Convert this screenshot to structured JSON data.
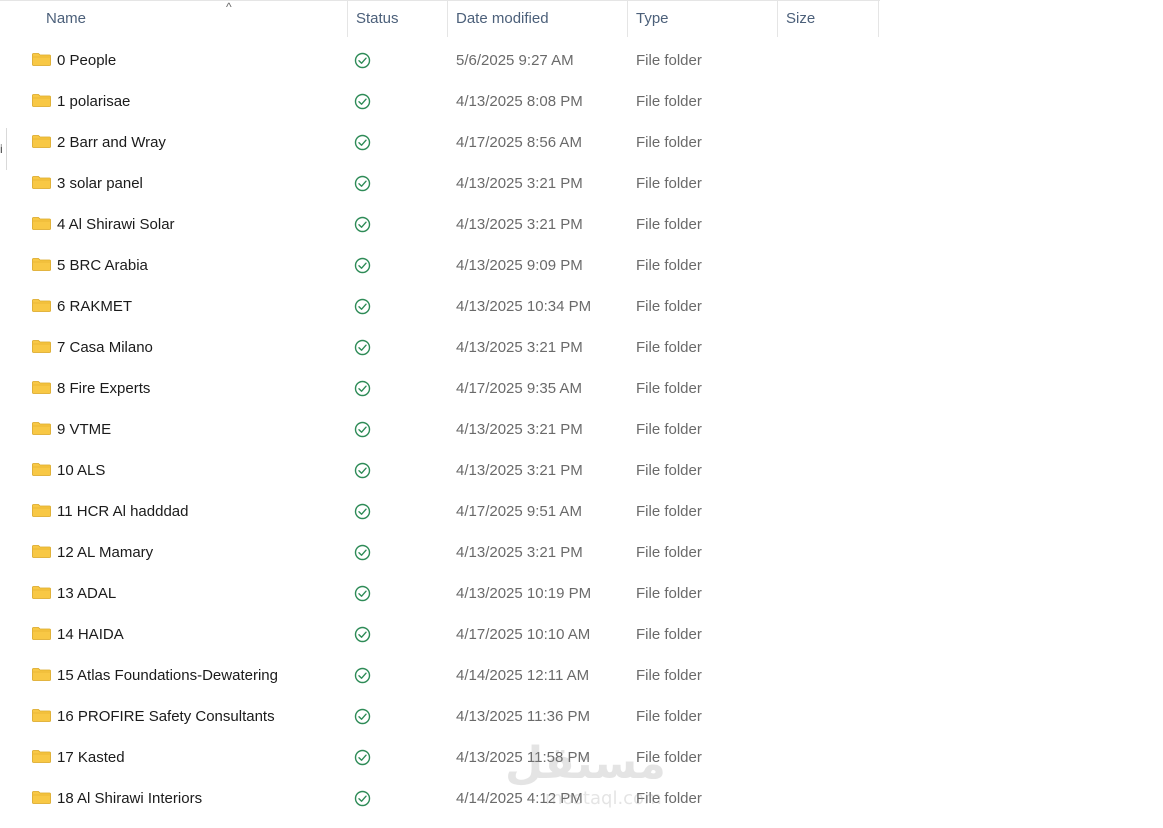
{
  "columns": {
    "name": "Name",
    "status": "Status",
    "date": "Date modified",
    "type": "Type",
    "size": "Size"
  },
  "sort_indicator": "^",
  "left_edge_char": "i",
  "colors": {
    "folder": "#f8c845",
    "status_ok": "#2e8b57",
    "header_text": "#4c607a"
  },
  "rows": [
    {
      "name": "0 People",
      "date": "5/6/2025 9:27 AM",
      "type": "File folder"
    },
    {
      "name": "1 polarisae",
      "date": "4/13/2025 8:08 PM",
      "type": "File folder"
    },
    {
      "name": "2 Barr and Wray",
      "date": "4/17/2025 8:56 AM",
      "type": "File folder"
    },
    {
      "name": "3 solar panel",
      "date": "4/13/2025 3:21 PM",
      "type": "File folder"
    },
    {
      "name": "4 Al Shirawi Solar",
      "date": "4/13/2025 3:21 PM",
      "type": "File folder"
    },
    {
      "name": "5 BRC Arabia",
      "date": "4/13/2025 9:09 PM",
      "type": "File folder"
    },
    {
      "name": "6 RAKMET",
      "date": "4/13/2025 10:34 PM",
      "type": "File folder"
    },
    {
      "name": "7 Casa Milano",
      "date": "4/13/2025 3:21 PM",
      "type": "File folder"
    },
    {
      "name": "8 Fire Experts",
      "date": "4/17/2025 9:35 AM",
      "type": "File folder"
    },
    {
      "name": "9 VTME",
      "date": "4/13/2025 3:21 PM",
      "type": "File folder"
    },
    {
      "name": "10 ALS",
      "date": "4/13/2025 3:21 PM",
      "type": "File folder"
    },
    {
      "name": "11 HCR Al hadddad",
      "date": "4/17/2025 9:51 AM",
      "type": "File folder"
    },
    {
      "name": "12 AL Mamary",
      "date": "4/13/2025 3:21 PM",
      "type": "File folder"
    },
    {
      "name": "13 ADAL",
      "date": "4/13/2025 10:19 PM",
      "type": "File folder"
    },
    {
      "name": "14 HAIDA",
      "date": "4/17/2025 10:10 AM",
      "type": "File folder"
    },
    {
      "name": "15 Atlas Foundations-Dewatering",
      "date": "4/14/2025 12:11 AM",
      "type": "File folder"
    },
    {
      "name": "16 PROFIRE Safety Consultants",
      "date": "4/13/2025 11:36 PM",
      "type": "File folder"
    },
    {
      "name": "17 Kasted",
      "date": "4/13/2025 11:58 PM",
      "type": "File folder"
    },
    {
      "name": "18 Al Shirawi Interiors",
      "date": "4/14/2025 4:12 PM",
      "type": "File folder"
    }
  ],
  "watermark": {
    "text_ar": "مستقل",
    "text_url": "mostaql.com"
  }
}
